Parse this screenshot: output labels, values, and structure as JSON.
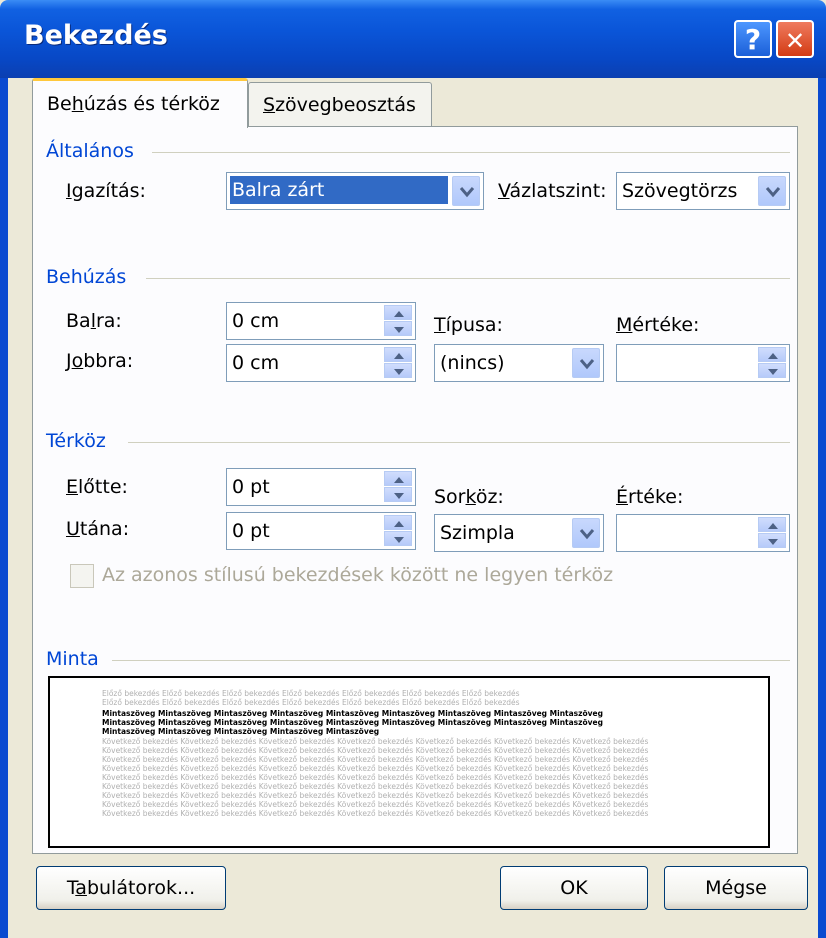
{
  "window": {
    "title": "Bekezdés",
    "help_glyph": "?",
    "close_glyph": "✕"
  },
  "tabs": [
    {
      "label_pre": "Be",
      "label_key": "h",
      "label_post": "úzás és térköz"
    },
    {
      "label_pre": "",
      "label_key": "S",
      "label_post": "zövegbeosztás"
    }
  ],
  "general": {
    "title": "Általános",
    "alignment_label_key": "I",
    "alignment_label_post": "gazítás:",
    "alignment_value": "Balra zárt",
    "outline_label_key": "V",
    "outline_label_post": "ázlatszint:",
    "outline_value": "Szövegtörzs"
  },
  "indent": {
    "title": "Behúzás",
    "left_label_pre": "Ba",
    "left_label_key": "l",
    "left_label_post": "ra:",
    "left_value": "0 cm",
    "right_label_pre": "J",
    "right_label_key": "o",
    "right_label_post": "bbra:",
    "right_value": "0 cm",
    "special_label_key": "T",
    "special_label_post": "ípusa:",
    "special_value": "(nincs)",
    "by_label_key": "M",
    "by_label_post": "értéke:",
    "by_value": ""
  },
  "spacing": {
    "title": "Térköz",
    "before_label_key": "E",
    "before_label_post": "lőtte:",
    "before_value": "0 pt",
    "after_label_key": "U",
    "after_label_post": "tána:",
    "after_value": "0 pt",
    "line_label_pre": "Sor",
    "line_label_key": "k",
    "line_label_post": "öz:",
    "line_value": "Szimpla",
    "at_label_key": "É",
    "at_label_post": "rtéke:",
    "at_value": "",
    "checkbox_label": "Az azonos stílusú bekezdések között ne legyen térköz",
    "checkbox_checked": false
  },
  "preview": {
    "title": "Minta",
    "prev_word": "Előző bekezdés",
    "sample_word": "Mintaszöveg",
    "next_word": "Következő bekezdés"
  },
  "buttons": {
    "tabs_pre": "T",
    "tabs_key": "a",
    "tabs_post": "bulátorok...",
    "ok": "OK",
    "cancel": "Mégse"
  },
  "colors": {
    "title_bar": "#0a55d8",
    "group_title": "#0046d5",
    "selection": "#316ac5"
  }
}
